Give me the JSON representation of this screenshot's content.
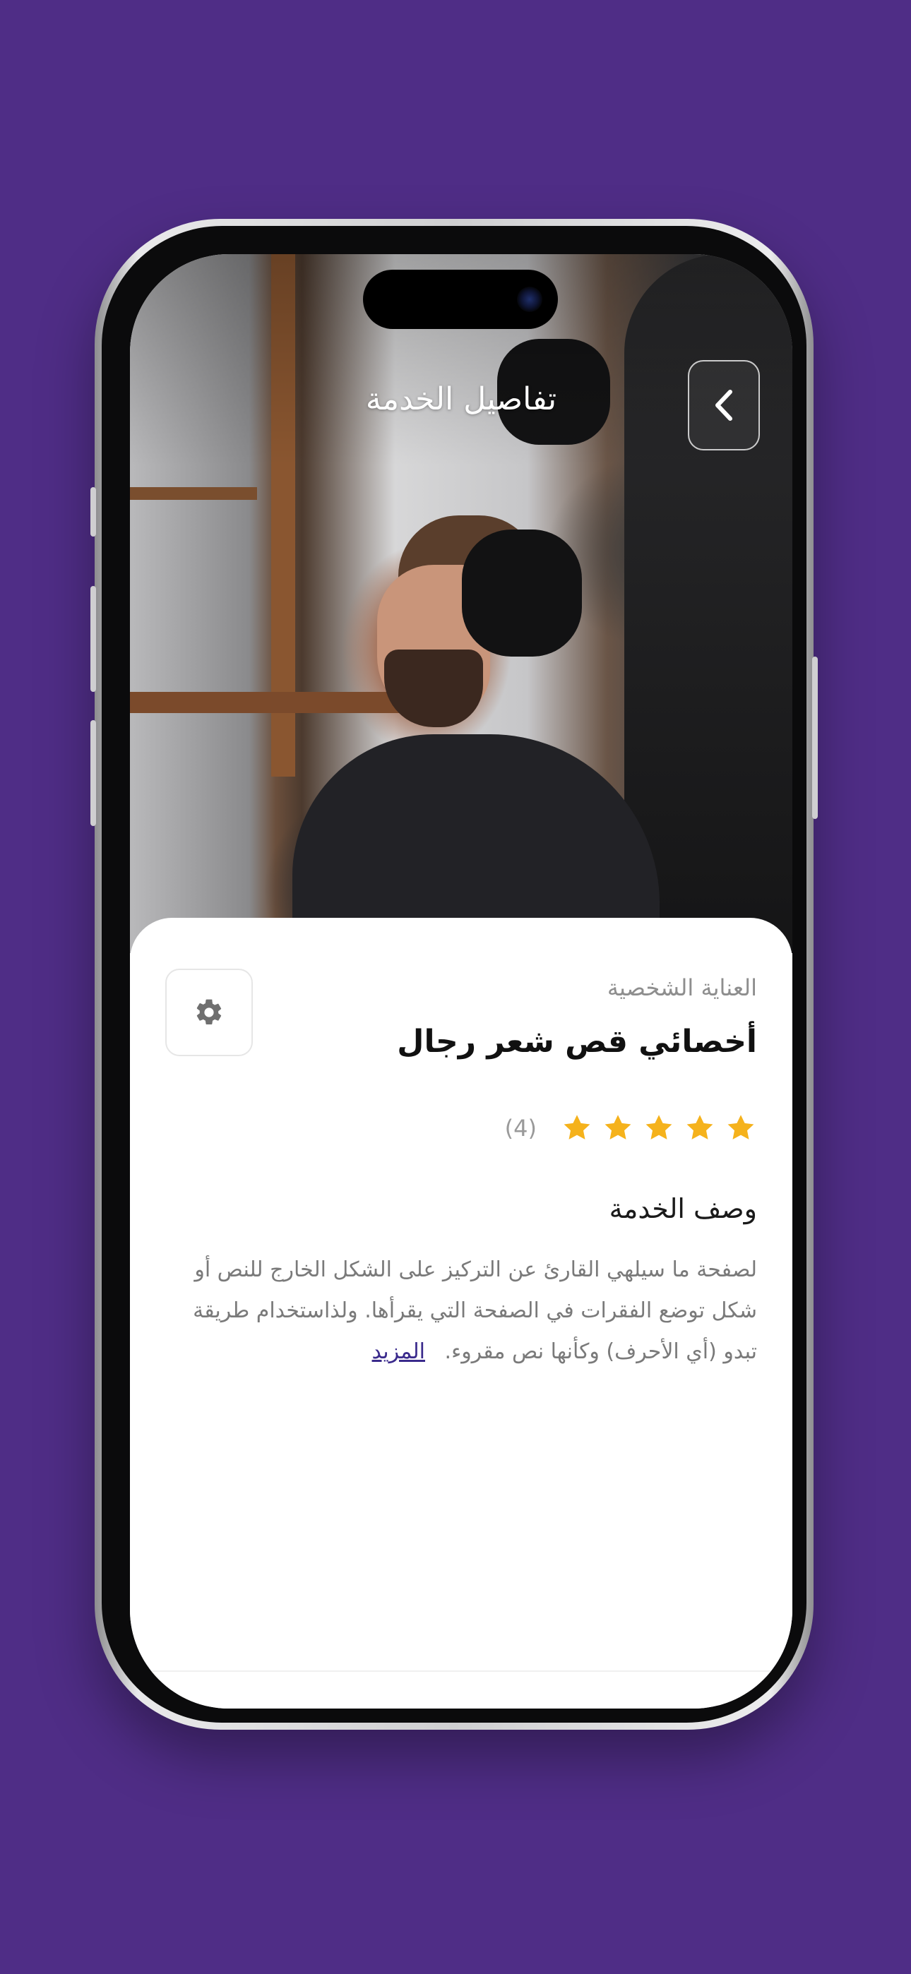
{
  "header": {
    "title": "تفاصيل الخدمة",
    "back_icon": "chevron-left-icon"
  },
  "service": {
    "category": "العناية الشخصية",
    "name": "أخصائي قص شعر رجال",
    "rating": {
      "stars": 5,
      "max": 5,
      "count_label": "(4)"
    },
    "settings_icon": "gear-icon"
  },
  "description": {
    "heading": "وصف الخدمة",
    "text": "لصفحة ما سيلهي القارئ عن التركيز على الشكل الخارج للنص أو شكل توضع الفقرات في الصفحة التي يقرأها. ولذاستخدام طريقة تبدو (أي الأحرف) وكأنها نص مقروء.",
    "more_label": "المزيد"
  },
  "colors": {
    "background": "#4f2d86",
    "star": "#f5b21c",
    "link": "#3a2a8c"
  }
}
